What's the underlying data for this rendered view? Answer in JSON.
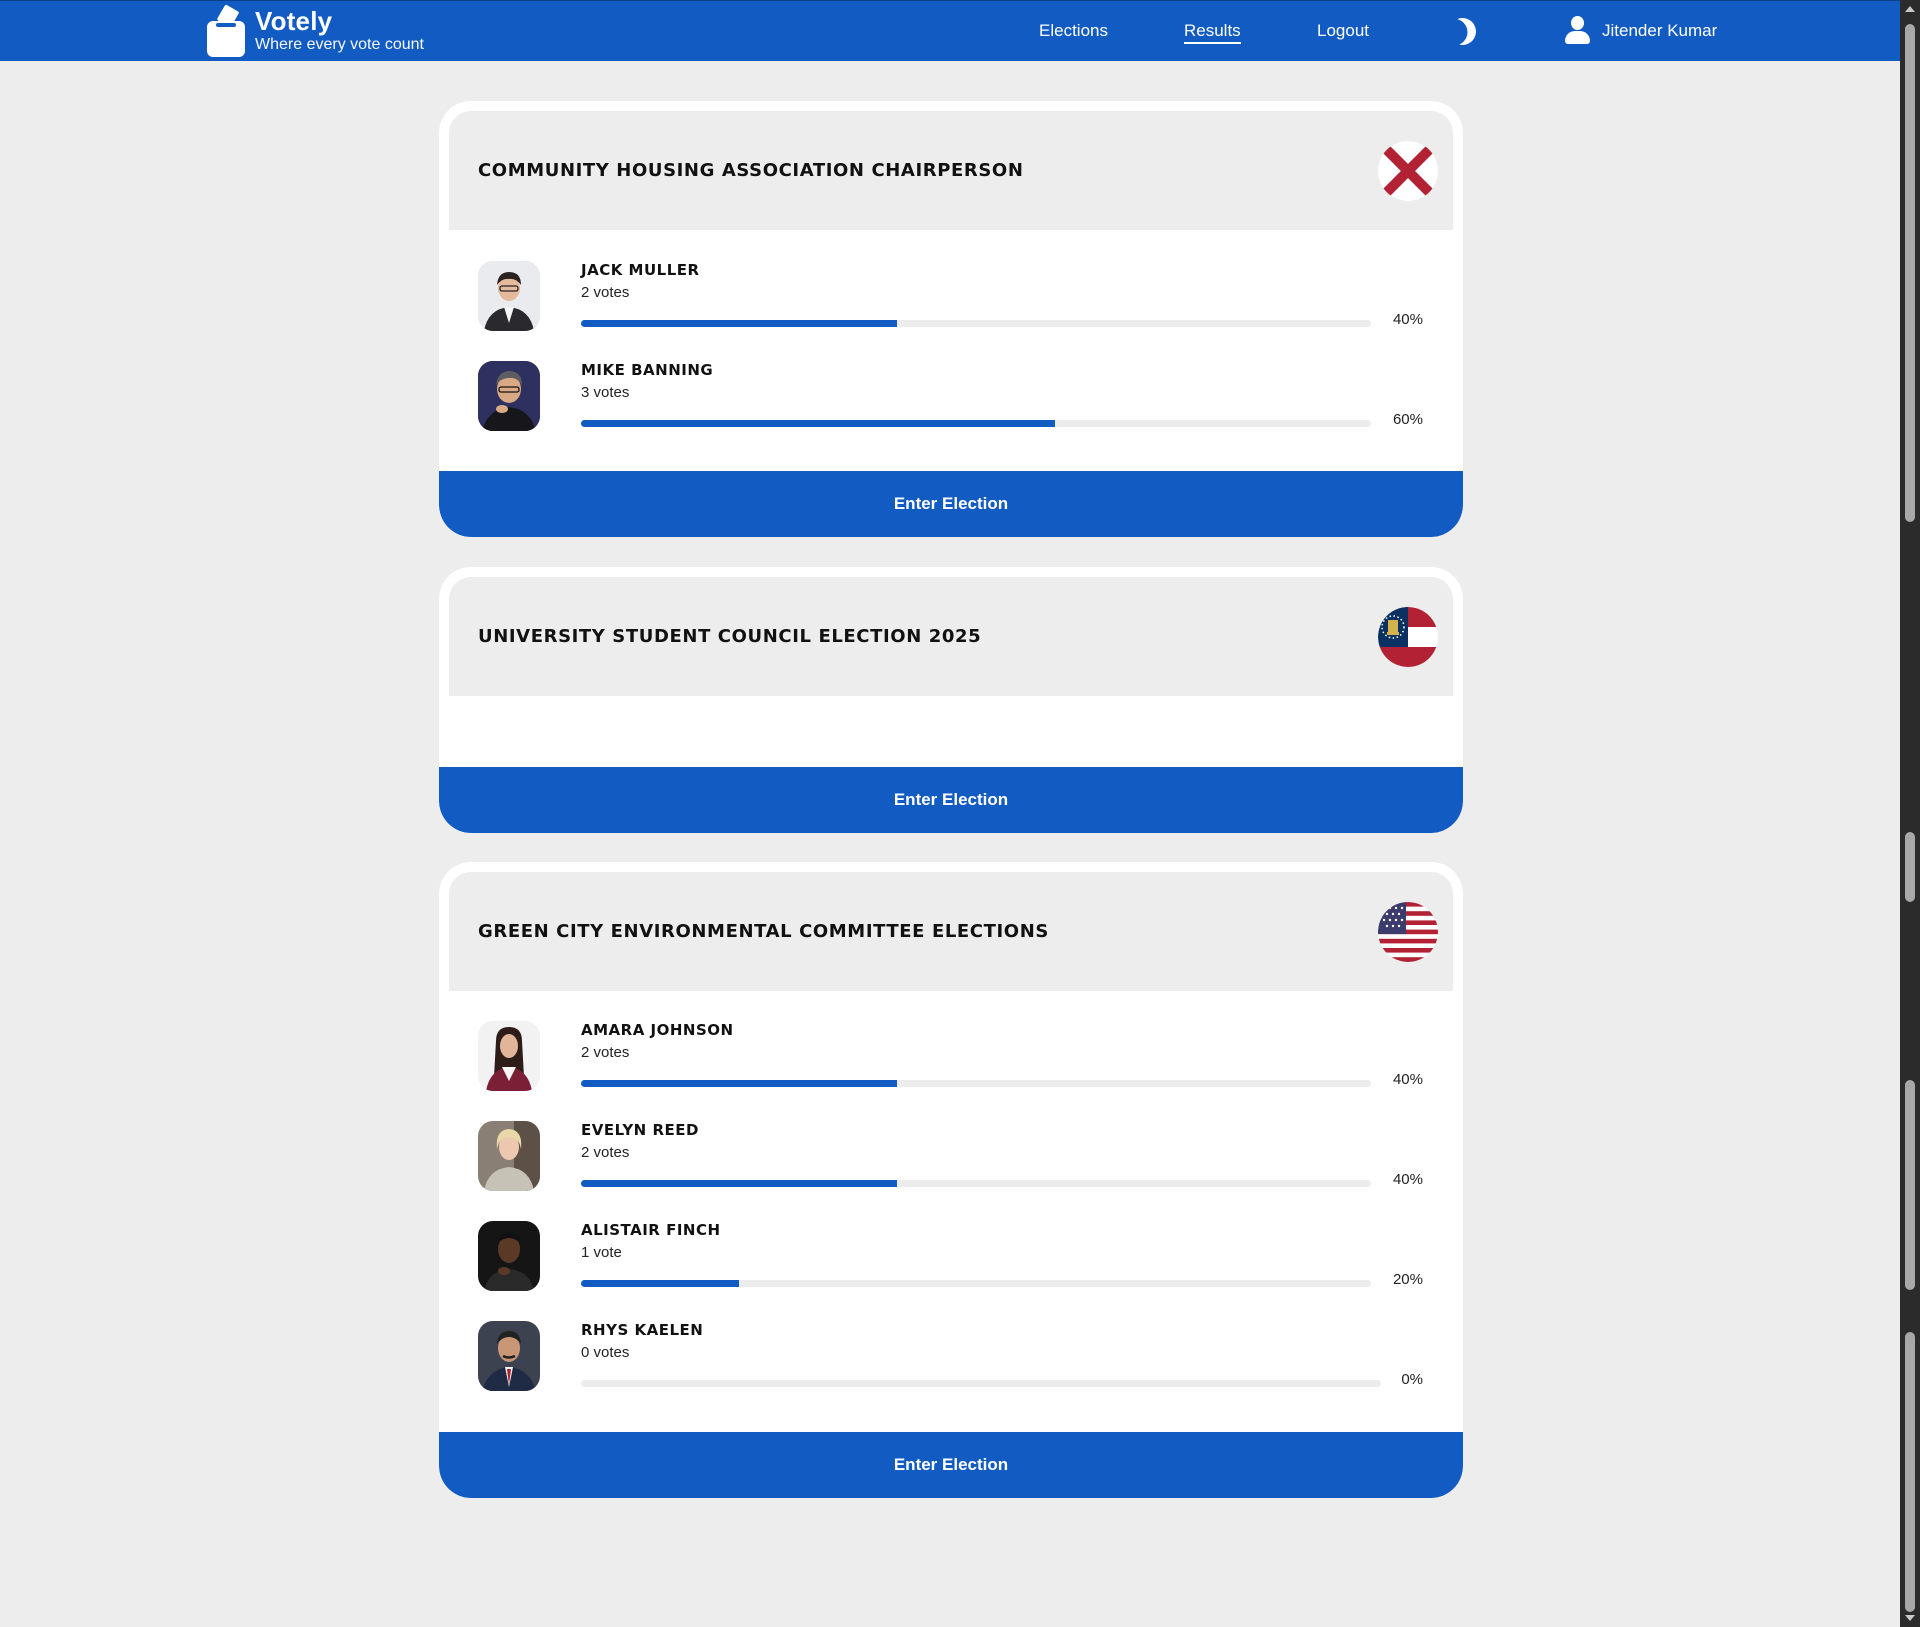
{
  "brand": {
    "name": "Votely",
    "tagline": "Where every vote count"
  },
  "nav": {
    "elections_label": "Elections",
    "results_label": "Results",
    "logout_label": "Logout",
    "theme_toggle_icon": "moon-icon",
    "user_icon": "user-icon",
    "user_name": "Jitender Kumar"
  },
  "colors": {
    "primary": "#115bc2",
    "background": "#ededed",
    "card": "#ffffff"
  },
  "elections": [
    {
      "title": "COMMUNITY HOUSING ASSOCIATION CHAIRPERSON",
      "flag_icon": "alabama-flag-icon",
      "button_label": "Enter Election",
      "candidates": [
        {
          "name": "JACK MULLER",
          "votes": "2 votes",
          "percent_label": "40%",
          "percent": 40
        },
        {
          "name": "MIKE BANNING",
          "votes": "3 votes",
          "percent_label": "60%",
          "percent": 60
        }
      ]
    },
    {
      "title": "UNIVERSITY STUDENT COUNCIL ELECTION 2025",
      "flag_icon": "georgia-flag-icon",
      "button_label": "Enter Election",
      "candidates": []
    },
    {
      "title": "GREEN CITY ENVIRONMENTAL COMMITTEE ELECTIONS",
      "flag_icon": "usa-flag-icon",
      "button_label": "Enter Election",
      "candidates": [
        {
          "name": "AMARA JOHNSON",
          "votes": "2 votes",
          "percent_label": "40%",
          "percent": 40
        },
        {
          "name": "EVELYN REED",
          "votes": "2 votes",
          "percent_label": "40%",
          "percent": 40
        },
        {
          "name": "ALISTAIR FINCH",
          "votes": "1 vote",
          "percent_label": "20%",
          "percent": 20
        },
        {
          "name": "RHYS KAELEN",
          "votes": "0 votes",
          "percent_label": "0%",
          "percent": 0
        }
      ]
    }
  ]
}
